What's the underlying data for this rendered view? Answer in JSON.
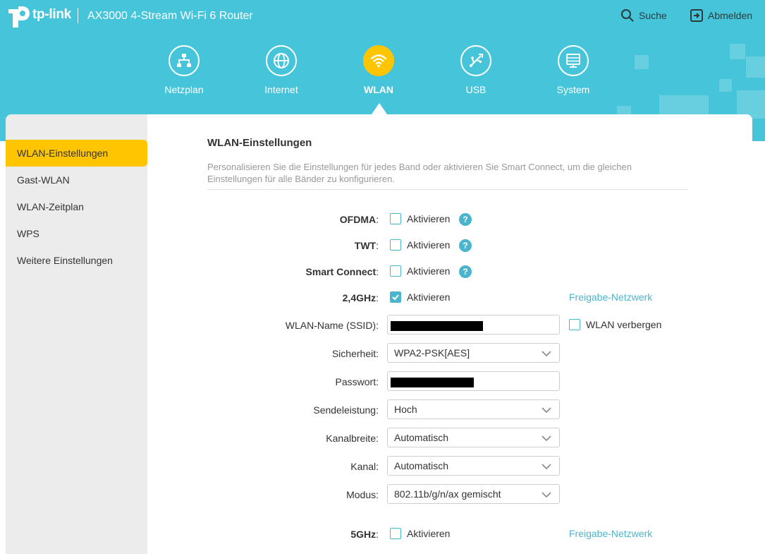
{
  "brand": {
    "logo_text": "tp-link",
    "model": "AX3000 4-Stream Wi-Fi 6 Router"
  },
  "top_actions": {
    "search": "Suche",
    "logout": "Abmelden"
  },
  "nav": [
    {
      "label": "Netzplan",
      "icon": "network-map-icon",
      "active": false
    },
    {
      "label": "Internet",
      "icon": "globe-icon",
      "active": false
    },
    {
      "label": "WLAN",
      "icon": "wifi-icon",
      "active": true
    },
    {
      "label": "USB",
      "icon": "usb-icon",
      "active": false
    },
    {
      "label": "System",
      "icon": "system-icon",
      "active": false
    }
  ],
  "sidebar": {
    "items": [
      {
        "label": "WLAN-Einstellungen",
        "active": true
      },
      {
        "label": "Gast-WLAN",
        "active": false
      },
      {
        "label": "WLAN-Zeitplan",
        "active": false
      },
      {
        "label": "WPS",
        "active": false
      },
      {
        "label": "Weitere Einstellungen",
        "active": false
      }
    ]
  },
  "main": {
    "title": "WLAN-Einstellungen",
    "description": "Personalisieren Sie die Einstellungen für jedes Band oder aktivieren Sie Smart Connect, um die gleichen Einstellungen für alle Bänder zu konfigurieren.",
    "enable_label": "Aktivieren",
    "colon": ":",
    "ofdma": {
      "label": "OFDMA",
      "checked": false
    },
    "twt": {
      "label": "TWT",
      "checked": false
    },
    "smart_connect": {
      "label": "Smart Connect",
      "checked": false
    },
    "band_24": {
      "label": "2,4GHz",
      "checked": true,
      "share_link": "Freigabe-Netzwerk"
    },
    "ssid": {
      "label": "WLAN-Name (SSID)",
      "value": "",
      "hide_label": "WLAN verbergen",
      "hide_checked": false
    },
    "security": {
      "label": "Sicherheit",
      "value": "WPA2-PSK[AES]"
    },
    "password": {
      "label": "Passwort",
      "value": ""
    },
    "tx_power": {
      "label": "Sendeleistung",
      "value": "Hoch"
    },
    "channel_width": {
      "label": "Kanalbreite",
      "value": "Automatisch"
    },
    "channel": {
      "label": "Kanal",
      "value": "Automatisch"
    },
    "mode": {
      "label": "Modus",
      "value": "802.11b/g/n/ax gemischt"
    },
    "band_5": {
      "label": "5GHz",
      "checked": false,
      "share_link": "Freigabe-Netzwerk"
    }
  },
  "colors": {
    "header": "#46c5da",
    "accent": "#ffc500",
    "link": "#4ab5cd"
  }
}
